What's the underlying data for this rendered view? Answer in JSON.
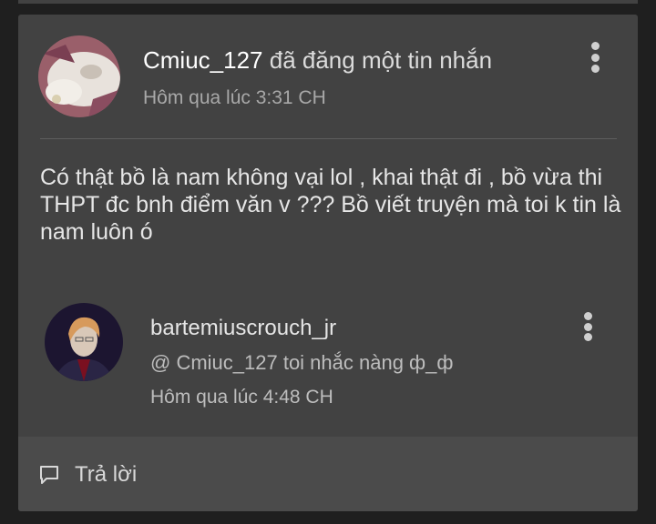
{
  "post": {
    "username": "Cmiuc_127",
    "action": " đã đăng một tin nhắn",
    "time": "Hôm qua lúc 3:31 CH",
    "body": "Có thật bồ là nam không vại lol , khai thật đi , bồ vừa thi THPT đc bnh điểm văn v ??? Bồ viết truyện mà toi k tin là nam luôn ó"
  },
  "reply": {
    "username": "bartemiuscrouch_jr",
    "text": "@ Cmiuc_127  toi nhắc nàng ф_ф",
    "time": "Hôm qua lúc 4:48 CH"
  },
  "footer": {
    "reply_label": "Trả lời"
  },
  "icons": {
    "more": "more-vertical-icon",
    "reply": "comment-icon"
  },
  "colors": {
    "card": "#424242",
    "footer": "#4b4b4b",
    "background": "#1f1f1f"
  }
}
